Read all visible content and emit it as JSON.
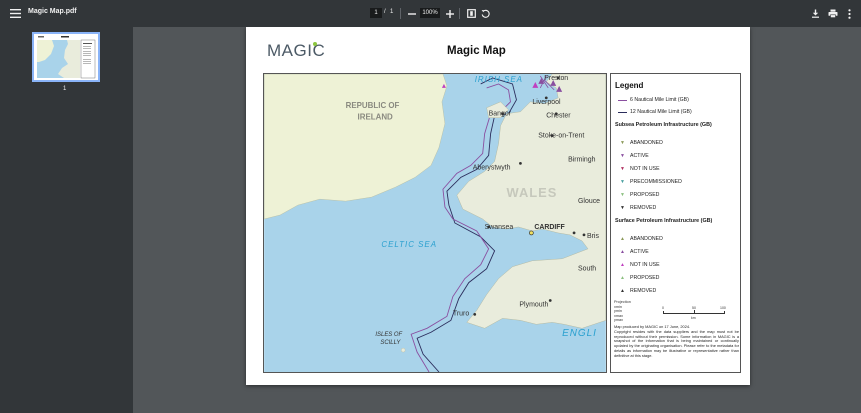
{
  "toolbar": {
    "file_name": "Magic Map.pdf",
    "page_current": "1",
    "page_separator": "/",
    "page_total": "1",
    "zoom": "100%",
    "icons": [
      "menu-icon",
      "zoom-out-icon",
      "zoom-in-icon",
      "fit-page-icon",
      "rotate-icon",
      "download-icon",
      "print-icon",
      "more-vert-icon"
    ]
  },
  "sidebar": {
    "thumbnail_label": "1"
  },
  "document": {
    "logo": "MAGIC",
    "title": "Magic Map",
    "map_labels": {
      "irish_sea": "IRISH SEA",
      "ireland": "REPUBLIC OF IRELAND",
      "wales": "WALES",
      "celtic_sea": "CELTIC SEA",
      "english": "ENGLI",
      "scilly": "ISLES OF SCILLY",
      "cities": [
        "Preston",
        "Liverpool",
        "Chester",
        "Bangor",
        "Stoke-on-Trent",
        "Aberystwyth",
        "Birmingh",
        "Glouce",
        "Swansea",
        "CARDIFF",
        "Bris",
        "South",
        "Plymouth",
        "Truro"
      ]
    },
    "legend": {
      "title": "Legend",
      "limits": [
        "6 Nautical Mile Limit (GB)",
        "12 Nautical Mile Limit (GB)"
      ],
      "subsea_heading": "Subsea Petroleum Infrastructure (GB)",
      "subsea_items": [
        "ABANDONED",
        "ACTIVE",
        "NOT IN USE",
        "PRECOMMISSIONED",
        "PROPOSED",
        "REMOVED"
      ],
      "surface_heading": "Surface Petroleum Infrastructure (GB)",
      "surface_items": [
        "ABANDONED",
        "ACTIVE",
        "NOT IN USE",
        "PROPOSED",
        "REMOVED"
      ],
      "projection_labels": [
        "Projection",
        "xmin",
        "ymin",
        "xmax",
        "ymax"
      ],
      "scale_ticks": [
        "0",
        "50",
        "100"
      ],
      "scale_unit": "km",
      "credit": "Map produced by MAGIC on 17 June, 2024.",
      "copyright": "Copyright resides with the data suppliers and the map must not be reproduced without their permission. Some information in MAGIC is a snapshot of the information that is being maintained or continually updated by the originating organisation. Please refer to the metadata for details as information may be illustrative or representative rather than definitive at this stage."
    },
    "colors": {
      "sea": "#a9d3ea",
      "land_ireland": "#eef2d6",
      "land_gb": "#e9ecdc",
      "limit_6nm": "#8a4fa0",
      "limit_12nm": "#2b2d5c",
      "sea_label": "#2aa0cf"
    }
  }
}
